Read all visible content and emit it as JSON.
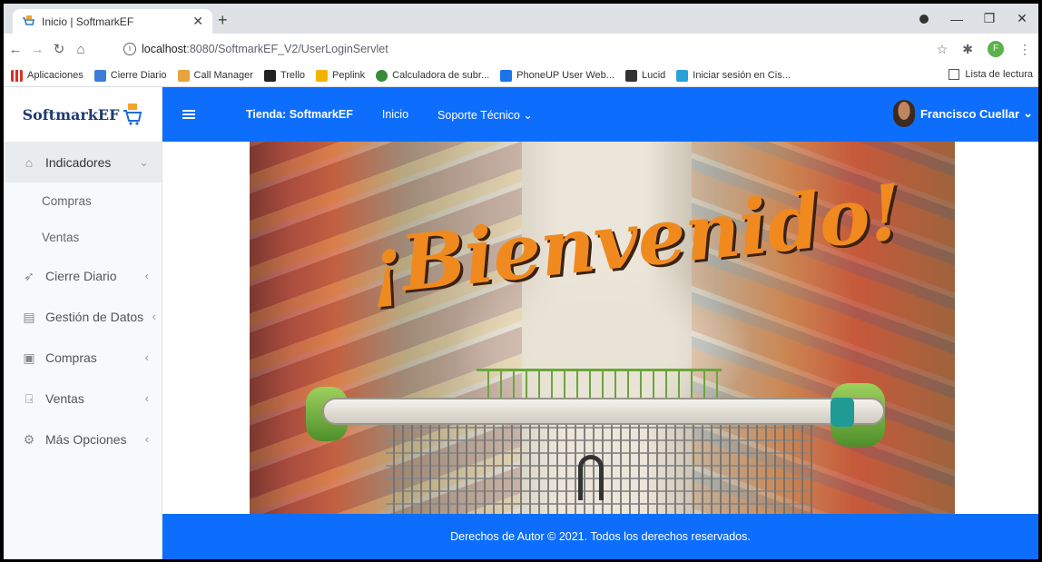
{
  "browser": {
    "tab_title": "Inicio | SoftmarkEF",
    "url_host": "localhost",
    "url_rest": ":8080/SoftmarkEF_V2/UserLoginServlet",
    "profile_initial": "F"
  },
  "bookmarks": {
    "items": [
      {
        "label": "Aplicaciones",
        "color": "#d93025"
      },
      {
        "label": "Cierre Diario",
        "color": "#3b7dd8"
      },
      {
        "label": "Call Manager",
        "color": "#e8a33b"
      },
      {
        "label": "Trello",
        "color": "#222222"
      },
      {
        "label": "Peplink",
        "color": "#f2b400"
      },
      {
        "label": "Calculadora de subr...",
        "color": "#3a8a3a"
      },
      {
        "label": "PhoneUP User Web...",
        "color": "#1a73e8"
      },
      {
        "label": "Lucid",
        "color": "#333333"
      },
      {
        "label": "Iniciar sesión en Cis...",
        "color": "#2aa0d8"
      }
    ],
    "reading_list": "Lista de lectura"
  },
  "app": {
    "logo": "SoftmarkEF",
    "nav": {
      "store": "Tienda: SoftmarkEF",
      "home": "Inicio",
      "support": "Soporte Técnico"
    },
    "user": "Francisco Cuellar",
    "sidebar": {
      "indicadores": "Indicadores",
      "compras_sub": "Compras",
      "ventas_sub": "Ventas",
      "cierre": "Cierre Diario",
      "gestion": "Gestión de Datos",
      "compras": "Compras",
      "ventas": "Ventas",
      "mas": "Más Opciones"
    },
    "banner_text": "¡Bienvenido!",
    "footer": "Derechos de Autor © 2021. Todos los derechos reservados."
  },
  "colors": {
    "primary": "#0d6efd",
    "accent": "#f08a1f"
  }
}
